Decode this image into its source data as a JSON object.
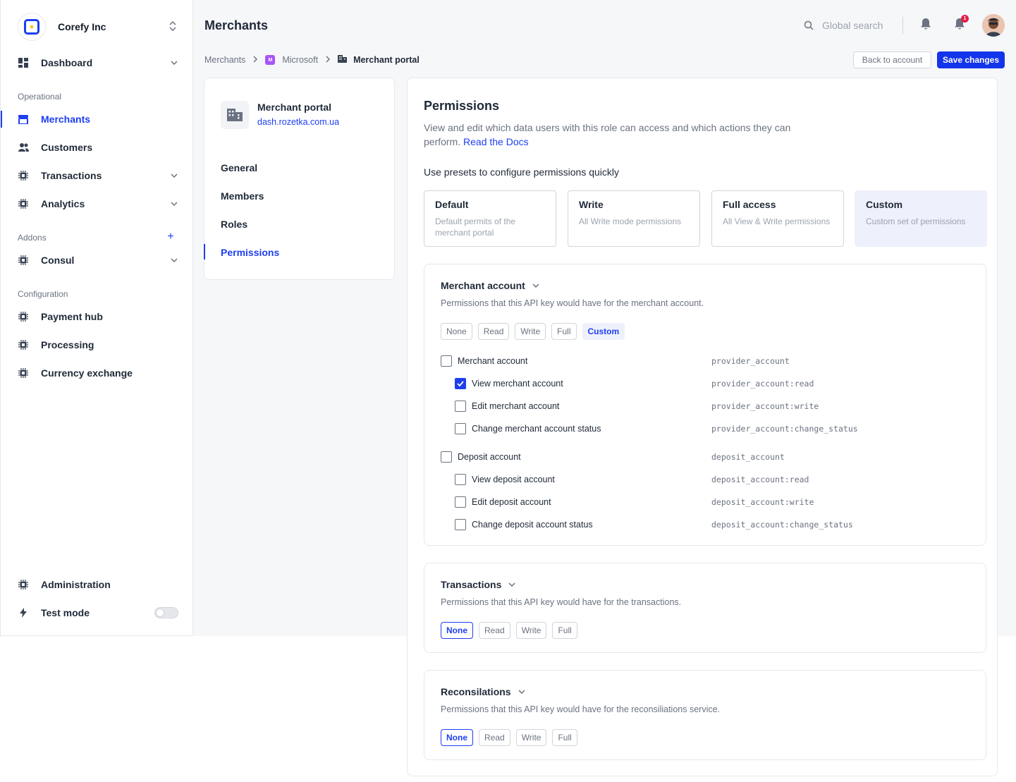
{
  "org": {
    "name": "Corefy Inc"
  },
  "sidebar": {
    "dashboard": "Dashboard",
    "section_operational": "Operational",
    "merchants": "Merchants",
    "customers": "Customers",
    "transactions": "Transactions",
    "analytics": "Analytics",
    "section_addons": "Addons",
    "consul": "Consul",
    "section_configuration": "Configuration",
    "payment_hub": "Payment hub",
    "processing": "Processing",
    "currency_exchange": "Currency exchange",
    "administration": "Administration",
    "test_mode": "Test mode",
    "test_mode_on": false
  },
  "header": {
    "title": "Merchants",
    "search_placeholder": "Global search",
    "notification_count": "1"
  },
  "breadcrumb": {
    "root": "Merchants",
    "merchant_initial": "M",
    "merchant": "Microsoft",
    "current": "Merchant portal"
  },
  "actions": {
    "back": "Back to account",
    "save": "Save changes"
  },
  "left_panel": {
    "title": "Merchant portal",
    "url": "dash.rozetka.com.ua",
    "items": [
      "General",
      "Members",
      "Roles",
      "Permissions"
    ],
    "active": "Permissions"
  },
  "permissions": {
    "title": "Permissions",
    "description": "View and edit which data users with this role can access and which actions they can perform.",
    "docs_link": "Read the Docs",
    "presets_label": "Use presets to configure permissions quickly",
    "presets": [
      {
        "title": "Default",
        "desc": "Default permits of the merchant portal"
      },
      {
        "title": "Write",
        "desc": "All Write mode permissions"
      },
      {
        "title": "Full access",
        "desc": "All View & Write permissions"
      },
      {
        "title": "Custom",
        "desc": "Custom set of permissions"
      }
    ],
    "selected_preset": "Custom"
  },
  "cards": {
    "merchant_account": {
      "title": "Merchant account",
      "desc": "Permissions that this API key would have for the merchant account.",
      "options": [
        "None",
        "Read",
        "Write",
        "Full",
        "Custom"
      ],
      "selected": "Custom",
      "groups": [
        {
          "label": "Merchant account",
          "code": "provider_account",
          "checked": false,
          "items": [
            {
              "label": "View merchant account",
              "code": "provider_account:read",
              "checked": true
            },
            {
              "label": "Edit merchant account",
              "code": "provider_account:write",
              "checked": false
            },
            {
              "label": "Change merchant account status",
              "code": "provider_account:change_status",
              "checked": false
            }
          ]
        },
        {
          "label": "Deposit account",
          "code": "deposit_account",
          "checked": false,
          "items": [
            {
              "label": "View deposit account",
              "code": "deposit_account:read",
              "checked": false
            },
            {
              "label": "Edit deposit account",
              "code": "deposit_account:write",
              "checked": false
            },
            {
              "label": "Change deposit account status",
              "code": "deposit_account:change_status",
              "checked": false
            }
          ]
        }
      ]
    },
    "transactions": {
      "title": "Transactions",
      "desc": "Permissions that this API key would have for the transactions.",
      "options": [
        "None",
        "Read",
        "Write",
        "Full"
      ],
      "selected": "None"
    },
    "reconsilations": {
      "title": "Reconsilations",
      "desc": "Permissions that this API key would have for the reconsiliations service.",
      "options": [
        "None",
        "Read",
        "Write",
        "Full"
      ],
      "selected": "None"
    }
  },
  "colors": {
    "accent": "#1d3ef0",
    "save_button": "#1234eb",
    "badge": "#e11d48"
  }
}
